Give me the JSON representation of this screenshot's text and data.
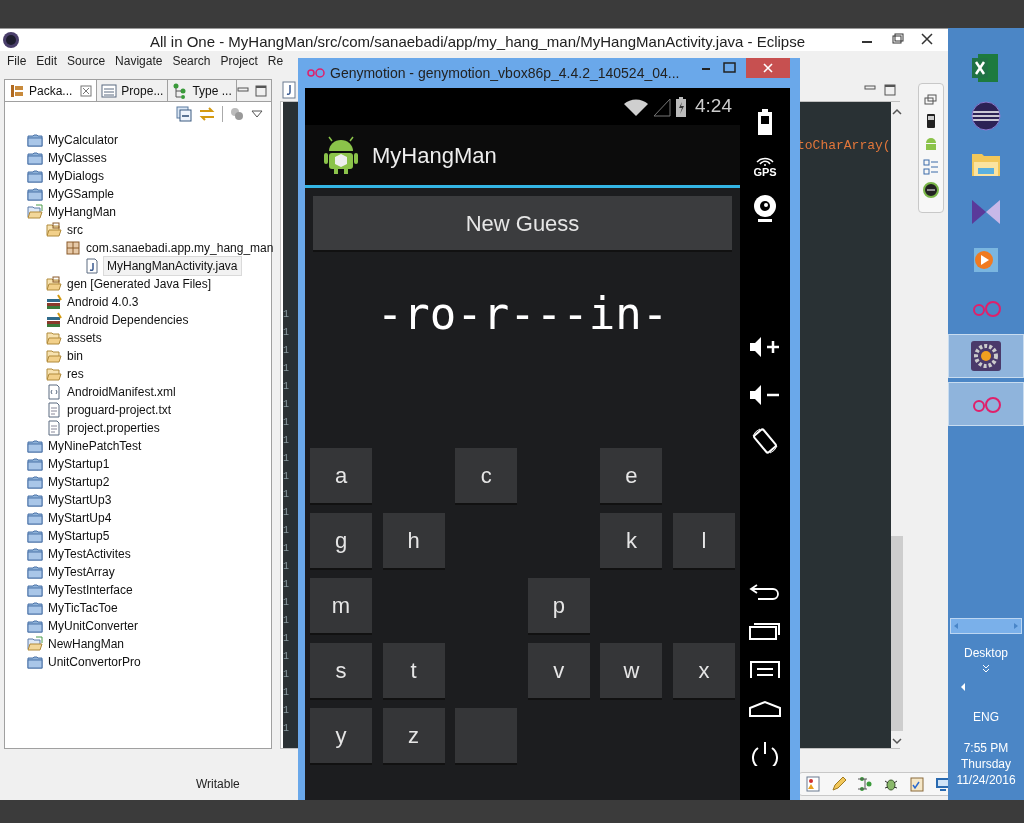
{
  "eclipse": {
    "title": "All in One - MyHangMan/src/com/sanaebadi/app/my_hang_man/MyHangManActivity.java - Eclipse",
    "menu": [
      "File",
      "Edit",
      "Source",
      "Navigate",
      "Search",
      "Project",
      "Re"
    ],
    "view_tabs": [
      {
        "label": "Packa...",
        "selected": true,
        "kind": "packages"
      },
      {
        "label": "Prope...",
        "selected": false,
        "kind": "properties"
      },
      {
        "label": "Type ...",
        "selected": false,
        "kind": "hierarchy"
      }
    ],
    "tree": [
      {
        "label": "MyCalculator",
        "kind": "project",
        "selected": false
      },
      {
        "label": "MyClasses",
        "kind": "project",
        "selected": false
      },
      {
        "label": "MyDialogs",
        "kind": "project",
        "selected": false
      },
      {
        "label": "MyGSample",
        "kind": "project",
        "selected": false
      },
      {
        "label": "MyHangMan",
        "kind": "open-project",
        "selected": false,
        "children": [
          {
            "label": "src",
            "kind": "source-folder",
            "selected": false,
            "children": [
              {
                "label": "com.sanaebadi.app.my_hang_man",
                "kind": "package",
                "selected": false,
                "children": [
                  {
                    "label": "MyHangManActivity.java",
                    "kind": "java-file",
                    "selected": true
                  }
                ]
              }
            ]
          },
          {
            "label": "gen [Generated Java Files]",
            "kind": "source-folder",
            "selected": false
          },
          {
            "label": "Android 4.0.3",
            "kind": "library",
            "selected": false
          },
          {
            "label": "Android Dependencies",
            "kind": "library",
            "selected": false
          },
          {
            "label": "assets",
            "kind": "folder",
            "selected": false
          },
          {
            "label": "bin",
            "kind": "folder",
            "selected": false
          },
          {
            "label": "res",
            "kind": "folder",
            "selected": false
          },
          {
            "label": "AndroidManifest.xml",
            "kind": "xml-file",
            "selected": false
          },
          {
            "label": "proguard-project.txt",
            "kind": "text-file",
            "selected": false
          },
          {
            "label": "project.properties",
            "kind": "text-file",
            "selected": false
          }
        ]
      },
      {
        "label": "MyNinePatchTest",
        "kind": "project",
        "selected": false
      },
      {
        "label": "MyStartup1",
        "kind": "project",
        "selected": false
      },
      {
        "label": "MyStartup2",
        "kind": "project",
        "selected": false
      },
      {
        "label": "MyStartUp3",
        "kind": "project",
        "selected": false
      },
      {
        "label": "MyStartUp4",
        "kind": "project",
        "selected": false
      },
      {
        "label": "MyStartup5",
        "kind": "project",
        "selected": false
      },
      {
        "label": "MyTestActivites",
        "kind": "project",
        "selected": false
      },
      {
        "label": "MyTestArray",
        "kind": "project",
        "selected": false
      },
      {
        "label": "MyTestInterface",
        "kind": "project",
        "selected": false
      },
      {
        "label": "MyTicTacToe",
        "kind": "project",
        "selected": false
      },
      {
        "label": "MyUnitConverter",
        "kind": "project",
        "selected": false
      },
      {
        "label": "NewHangMan",
        "kind": "open-project",
        "selected": false
      },
      {
        "label": "UnitConvertorPro",
        "kind": "project",
        "selected": false
      }
    ],
    "editor": {
      "code_fragment": "toCharArray(",
      "gutter": [
        "1",
        "1",
        "1",
        "1",
        "1",
        "1",
        "1",
        "1",
        "1",
        "1",
        "1",
        "1",
        "1",
        "1",
        "1",
        "1",
        "1",
        "1",
        "1",
        "1",
        "1",
        "1",
        "1",
        "1"
      ]
    },
    "status_bar": {
      "mode": "Writable"
    }
  },
  "genymotion": {
    "title": "Genymotion - genymotion_vbox86p_4.4.2_140524_04...",
    "phone": {
      "clock": "4:24",
      "app_title": "MyHangMan",
      "new_guess_button": "New Guess",
      "word": "-ro-r---in-",
      "keys": [
        {
          "kind": "key",
          "label": "a"
        },
        {
          "kind": "used"
        },
        {
          "kind": "key",
          "label": "c"
        },
        {
          "kind": "used"
        },
        {
          "kind": "key",
          "label": "e"
        },
        {
          "kind": "used"
        },
        {
          "kind": "key",
          "label": "g"
        },
        {
          "kind": "key",
          "label": "h"
        },
        {
          "kind": "used"
        },
        {
          "kind": "used"
        },
        {
          "kind": "key",
          "label": "k"
        },
        {
          "kind": "key",
          "label": "l"
        },
        {
          "kind": "key",
          "label": "m"
        },
        {
          "kind": "used"
        },
        {
          "kind": "used"
        },
        {
          "kind": "key",
          "label": "p"
        },
        {
          "kind": "used"
        },
        {
          "kind": "used"
        },
        {
          "kind": "key",
          "label": "s"
        },
        {
          "kind": "key",
          "label": "t"
        },
        {
          "kind": "used"
        },
        {
          "kind": "key",
          "label": "v"
        },
        {
          "kind": "key",
          "label": "w"
        },
        {
          "kind": "key",
          "label": "x"
        },
        {
          "kind": "key",
          "label": "y"
        },
        {
          "kind": "key",
          "label": "z"
        },
        {
          "kind": "blank"
        }
      ]
    },
    "side_panel": {
      "gps_label": "GPS"
    }
  },
  "taskbar": {
    "apps": [
      {
        "kind": "spreadsheet",
        "selected": false
      },
      {
        "kind": "eclipse",
        "selected": false
      },
      {
        "kind": "folder",
        "selected": false
      },
      {
        "kind": "studio",
        "selected": false
      },
      {
        "kind": "player",
        "selected": false
      },
      {
        "kind": "genymotion",
        "selected": false
      },
      {
        "kind": "gear",
        "selected": true
      },
      {
        "kind": "genymotion",
        "selected": true
      }
    ],
    "toolbar_label": "Desktop",
    "language": "ENG",
    "time": "7:55 PM",
    "day": "Thursday",
    "date": "11/24/2016"
  }
}
